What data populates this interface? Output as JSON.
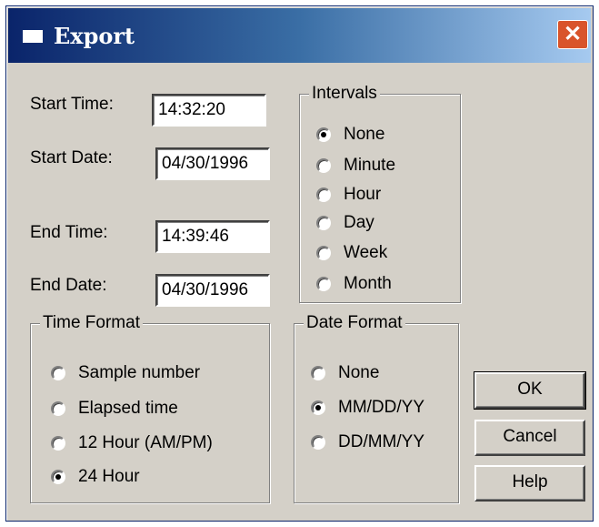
{
  "window": {
    "title": "Export",
    "close_glyph": "✕"
  },
  "fields": {
    "start_time": {
      "label": "Start Time:",
      "value": "14:32:20"
    },
    "start_date": {
      "label": "Start Date:",
      "value": "04/30/1996"
    },
    "end_time": {
      "label": "End Time:",
      "value": "14:39:46"
    },
    "end_date": {
      "label": "End Date:",
      "value": "04/30/1996"
    }
  },
  "intervals": {
    "title": "Intervals",
    "options": [
      "None",
      "Minute",
      "Hour",
      "Day",
      "Week",
      "Month"
    ],
    "selected": "None"
  },
  "time_format": {
    "title": "Time Format",
    "options": [
      "Sample number",
      "Elapsed time",
      "12 Hour (AM/PM)",
      "24 Hour"
    ],
    "selected": "24 Hour"
  },
  "date_format": {
    "title": "Date Format",
    "options": [
      "None",
      "MM/DD/YY",
      "DD/MM/YY"
    ],
    "selected": "MM/DD/YY"
  },
  "buttons": {
    "ok": "OK",
    "cancel": "Cancel",
    "help": "Help"
  },
  "colors": {
    "titlebar_start": "#0a246a",
    "titlebar_end": "#a6caf0",
    "face": "#d4d0c8",
    "close": "#d9542b"
  }
}
